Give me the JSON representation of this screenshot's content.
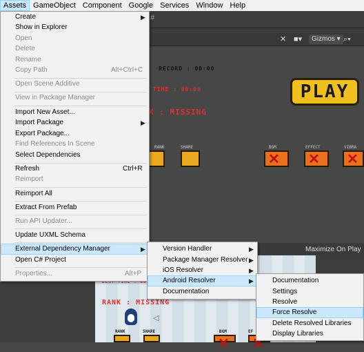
{
  "menubar": {
    "items": [
      "Assets",
      "GameObject",
      "Component",
      "Google",
      "Services",
      "Window",
      "Help"
    ]
  },
  "assets_menu": {
    "items": [
      {
        "label": "Create",
        "shortcut": "",
        "enabled": true,
        "submenu": true
      },
      {
        "label": "Show in Explorer",
        "shortcut": "",
        "enabled": true,
        "submenu": false
      },
      {
        "label": "Open",
        "shortcut": "",
        "enabled": false,
        "submenu": false
      },
      {
        "label": "Delete",
        "shortcut": "",
        "enabled": false,
        "submenu": false
      },
      {
        "label": "Rename",
        "shortcut": "",
        "enabled": false,
        "submenu": false
      },
      {
        "label": "Copy Path",
        "shortcut": "Alt+Ctrl+C",
        "enabled": false,
        "submenu": false
      },
      {
        "label": "Open Scene Additive",
        "shortcut": "",
        "enabled": false,
        "submenu": false
      },
      {
        "label": "View in Package Manager",
        "shortcut": "",
        "enabled": false,
        "submenu": false
      },
      {
        "label": "Import New Asset...",
        "shortcut": "",
        "enabled": true,
        "submenu": false
      },
      {
        "label": "Import Package",
        "shortcut": "",
        "enabled": true,
        "submenu": true
      },
      {
        "label": "Export Package...",
        "shortcut": "",
        "enabled": true,
        "submenu": false
      },
      {
        "label": "Find References In Scene",
        "shortcut": "",
        "enabled": false,
        "submenu": false
      },
      {
        "label": "Select Dependencies",
        "shortcut": "",
        "enabled": true,
        "submenu": false
      },
      {
        "label": "Refresh",
        "shortcut": "Ctrl+R",
        "enabled": true,
        "submenu": false
      },
      {
        "label": "Reimport",
        "shortcut": "",
        "enabled": false,
        "submenu": false
      },
      {
        "label": "Reimport All",
        "shortcut": "",
        "enabled": true,
        "submenu": false
      },
      {
        "label": "Extract From Prefab",
        "shortcut": "",
        "enabled": true,
        "submenu": false
      },
      {
        "label": "Run API Updater...",
        "shortcut": "",
        "enabled": false,
        "submenu": false
      },
      {
        "label": "Update UXML Schema",
        "shortcut": "",
        "enabled": true,
        "submenu": false
      },
      {
        "label": "External Dependency Manager",
        "shortcut": "",
        "enabled": true,
        "submenu": true
      },
      {
        "label": "Open C# Project",
        "shortcut": "",
        "enabled": true,
        "submenu": false
      },
      {
        "label": "Properties...",
        "shortcut": "Alt+P",
        "enabled": false,
        "submenu": false
      }
    ]
  },
  "edm_menu": {
    "items": [
      "Version Handler",
      "Package Manager Resolver",
      "iOS Resolver",
      "Android Resolver",
      "Documentation"
    ]
  },
  "android_menu": {
    "items": [
      "Documentation",
      "Settings",
      "Resolve",
      "Force Resolve",
      "Delete Resolved Libraries",
      "Display Libraries"
    ]
  },
  "scene": {
    "gizmos": "Gizmos",
    "record": "RECORD : 00:00",
    "time": "TIME : 00:00",
    "rank": "K : MISSING",
    "play": "PLAY",
    "icon_labels": [
      "RANK",
      "SHARE",
      "BGM",
      "EFFECT",
      "VIBRA"
    ]
  },
  "game": {
    "header": "Maximize On Play",
    "best_time": "BEST TIME : 00:00",
    "rank": "RANK : MISSING",
    "labels": [
      "RANK",
      "SHARE",
      "BGM",
      "EF"
    ]
  }
}
